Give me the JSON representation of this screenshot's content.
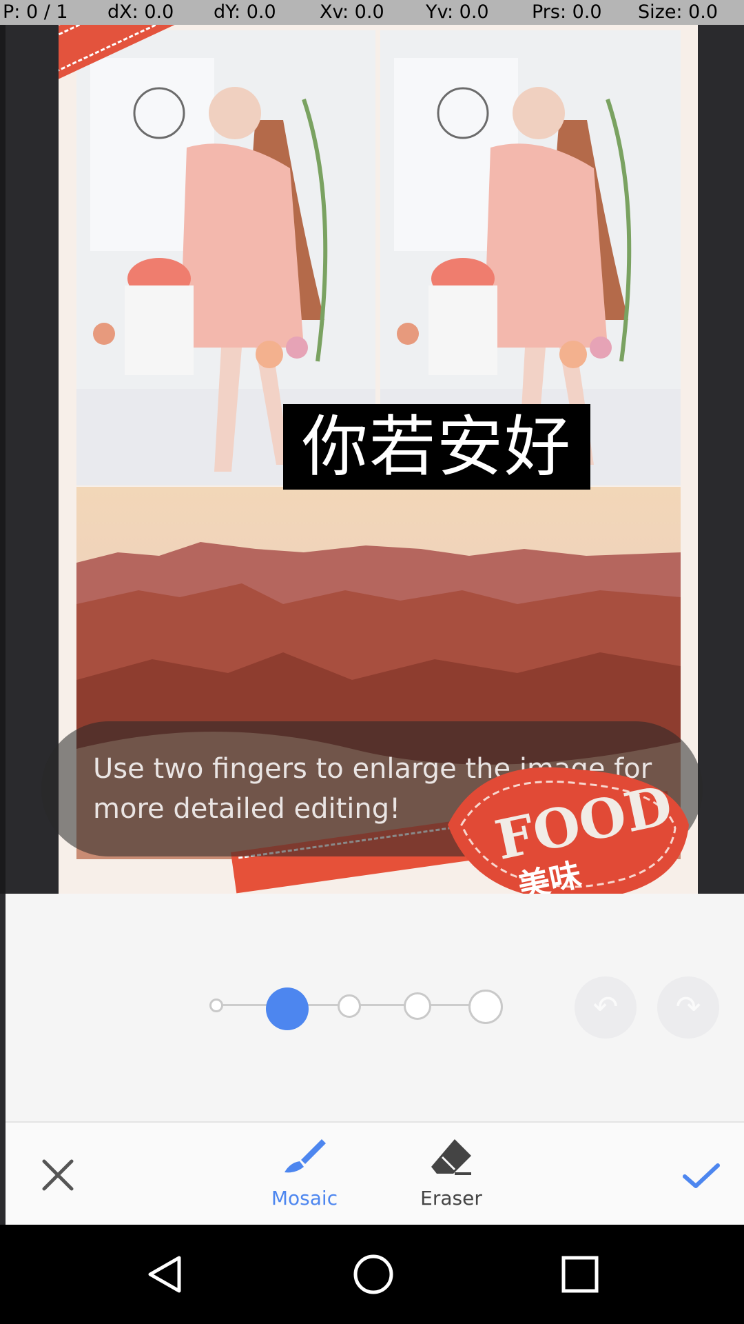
{
  "status_bar": {
    "pointer": "P: 0 / 1",
    "dx": "dX: 0.0",
    "dy": "dY: 0.0",
    "xv": "Xv: 0.0",
    "yv": "Yv: 0.0",
    "prs": "Prs: 0.0",
    "size": "Size: 0.0"
  },
  "poster": {
    "title": "你若安好",
    "logo_word": "FOOD",
    "logo_sub": "美味"
  },
  "toast": {
    "message": "Use two fingers to enlarge the image for more detailed editing!"
  },
  "brush_size": {
    "levels": 5,
    "selected_index": 1
  },
  "toolbar": {
    "cancel_icon": "close-icon",
    "mosaic_label": "Mosaic",
    "eraser_label": "Eraser",
    "confirm_icon": "check-icon",
    "accent": "#4d86ef"
  },
  "nav": {
    "back": "back-icon",
    "home": "home-icon",
    "recents": "recents-icon"
  }
}
